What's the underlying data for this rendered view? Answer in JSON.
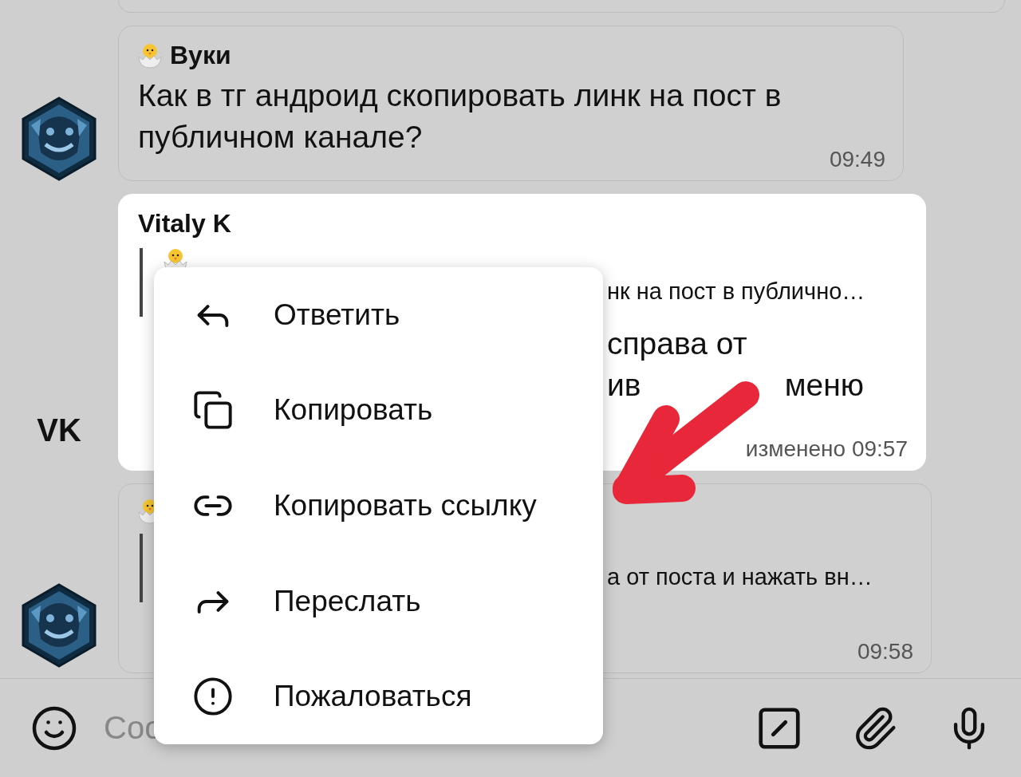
{
  "messages": [
    {
      "kind": "stub"
    },
    {
      "kind": "message",
      "sender": "Вуки",
      "text": "Как в тг андроид скопировать линк на пост в публичном канале?",
      "time": "09:49",
      "highlighted": false
    },
    {
      "kind": "message",
      "initials": "VK",
      "sender": "Vitaly K",
      "highlighted": true,
      "quote": {
        "text": "нк на пост в публично…"
      },
      "lines": [
        {
          "parts": [
            "справа от"
          ]
        },
        {
          "parts": [
            "ив",
            "меню"
          ]
        }
      ],
      "time": "изменено 09:57"
    },
    {
      "kind": "message",
      "highlighted": false,
      "quote": {
        "text": "а от поста и нажать вн…"
      },
      "time": "09:58"
    }
  ],
  "context_menu": {
    "items": [
      {
        "label": "Ответить"
      },
      {
        "label": "Копировать"
      },
      {
        "label": "Копировать ссылку"
      },
      {
        "label": "Переслать"
      },
      {
        "label": "Пожаловаться"
      }
    ]
  },
  "composer": {
    "placeholder": "Соо"
  }
}
